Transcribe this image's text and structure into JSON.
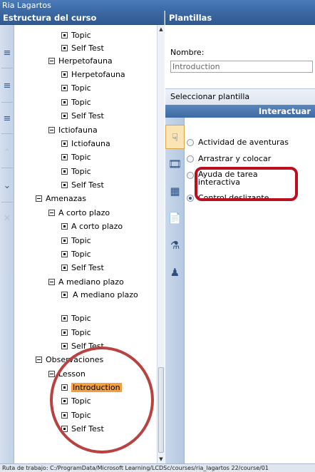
{
  "window": {
    "title": "Ria Lagartos"
  },
  "left_panel": {
    "title": "Estructura del curso",
    "tree": [
      {
        "label": "Topic",
        "box": "dot"
      },
      {
        "label": "Self Test",
        "box": "dot"
      },
      {
        "label": "Herpetofauna",
        "box": "minus"
      },
      {
        "label": "Herpetofauna",
        "box": "dot"
      },
      {
        "label": "Topic",
        "box": "dot"
      },
      {
        "label": "Topic",
        "box": "dot"
      },
      {
        "label": "Self Test",
        "box": "dot"
      },
      {
        "label": "Ictiofauna",
        "box": "minus"
      },
      {
        "label": "Ictiofauna",
        "box": "dot"
      },
      {
        "label": "Topic",
        "box": "dot"
      },
      {
        "label": "Topic",
        "box": "dot"
      },
      {
        "label": "Self Test",
        "box": "dot"
      },
      {
        "label": "Amenazas",
        "box": "minus"
      },
      {
        "label": "A corto plazo",
        "box": "minus"
      },
      {
        "label": "A corto plazo",
        "box": "dot"
      },
      {
        "label": "Topic",
        "box": "dot"
      },
      {
        "label": "Topic",
        "box": "dot"
      },
      {
        "label": "Self Test",
        "box": "dot"
      },
      {
        "label": "A mediano plazo",
        "box": "minus"
      },
      {
        "label": "A mediano plazo",
        "box": "dot"
      },
      {
        "label": "Topic",
        "box": "dot"
      },
      {
        "label": "Topic",
        "box": "dot"
      },
      {
        "label": "Self Test",
        "box": "dot"
      },
      {
        "label": "Observaciones",
        "box": "minus"
      },
      {
        "label": "Lesson",
        "box": "minus"
      },
      {
        "label": "Introduction",
        "box": "dot",
        "selected": true
      },
      {
        "label": "Topic",
        "box": "dot"
      },
      {
        "label": "Topic",
        "box": "dot"
      },
      {
        "label": "Self Test",
        "box": "dot"
      }
    ],
    "toolbar_icons": [
      "add-topic-icon",
      "add-subtopic-icon",
      "add-test-icon",
      "move-up-icon",
      "move-down-icon",
      "delete-icon"
    ]
  },
  "right_panel": {
    "title": "Plantillas",
    "name_label": "Nombre:",
    "name_value": "Introduction",
    "select_label": "Seleccionar plantilla",
    "category_header": "Interactuar",
    "options": [
      {
        "label": "Actividad de aventuras",
        "selected": false
      },
      {
        "label": "Arrastrar y colocar",
        "selected": false
      },
      {
        "label": "Ayuda de tarea interactiva",
        "selected": false
      },
      {
        "label": "Control deslizante",
        "selected": true
      }
    ],
    "tab_icons": [
      "interact-icon",
      "film-icon",
      "grid-icon",
      "document-icon",
      "lab-icon",
      "people-icon"
    ]
  },
  "status_bar": {
    "text": "Ruta de trabajo: C:/ProgramData/Microsoft Learning/LCDSc/courses/ria_lagartos 22/course/01"
  },
  "colors": {
    "annotation": "#b94141",
    "selection": "#f0a040",
    "header": "#3e6aa3"
  }
}
